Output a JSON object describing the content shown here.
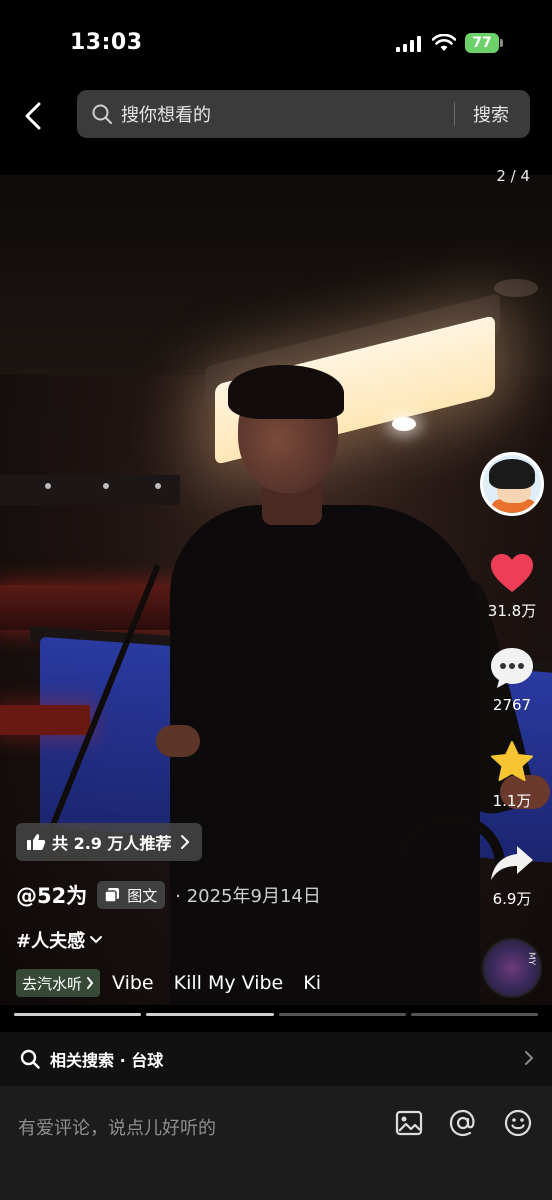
{
  "status_bar": {
    "time": "13:03",
    "battery": "77"
  },
  "header": {
    "search_placeholder": "搜你想看的",
    "search_button": "搜索",
    "page_counter": "2 / 4"
  },
  "rail": {
    "likes": "31.8万",
    "comments": "2767",
    "favorites": "1.1万",
    "shares": "6.9万"
  },
  "post": {
    "recommend": "共 2.9 万人推荐",
    "author": "@52为",
    "type_tag": "图文",
    "date": "2025年9月14日",
    "hashtag": "#人夫感",
    "music_pill": "去汽水听",
    "music_titles": [
      "Vibe",
      "Kill My Vibe",
      "Ki"
    ],
    "image_count": 4,
    "current_image": 2
  },
  "related": {
    "label": "相关搜索 · 台球"
  },
  "comment": {
    "placeholder": "有爱评论，说点儿好听的"
  },
  "colors": {
    "like": "#ee3e57",
    "favorite": "#f7c531",
    "battery": "#6dd16a"
  },
  "icons": [
    "back-icon",
    "search-icon",
    "heart-icon",
    "comment-icon",
    "star-icon",
    "share-icon",
    "thumbs-up-icon",
    "image-icon",
    "at-icon",
    "emoji-icon"
  ]
}
